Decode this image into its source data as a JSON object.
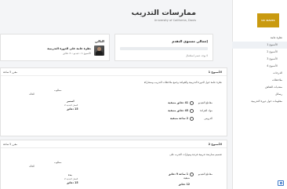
{
  "header": {
    "title": "ممارسات التدريب",
    "subtitle": "University of California, Davis"
  },
  "sidebar": {
    "logo_text": "UC DAVIS",
    "items": [
      {
        "label": "نظرة عامة",
        "sub": false,
        "active": false
      },
      {
        "label": "الأسبوع 1",
        "sub": true,
        "active": true
      },
      {
        "label": "الأسبوع 2",
        "sub": true,
        "active": false
      },
      {
        "label": "الأسبوع 3",
        "sub": true,
        "active": false
      },
      {
        "label": "الأسبوع 4",
        "sub": true,
        "active": false
      },
      {
        "label": "الدرجات",
        "sub": false,
        "active": false
      },
      {
        "label": "ملاحظات",
        "sub": false,
        "active": false
      },
      {
        "label": "منتديات النقاش",
        "sub": false,
        "active": false
      },
      {
        "label": "رسائل",
        "sub": false,
        "active": false
      },
      {
        "label": "معلومات حول دورة التدريبية",
        "sub": false,
        "active": false
      }
    ]
  },
  "progress_card": {
    "title": "إجمالي مستوى التقدم",
    "caption": "لا يوجد عنصر استكمال",
    "progress": 0
  },
  "next_card": {
    "title": "التالي",
    "item_title": "نظرة عامة على الدورة التدريبية",
    "item_meta": "الأسبوع 1 • فيديو • 3 دقائق"
  },
  "sections": [
    {
      "title": "الأسبوع 1",
      "due": "مقرر 5 ساعة",
      "description": "نظرة عامة حول الدورة التدريبية والقواعد وجمع ملاحظات التدريب ومشاركة",
      "col_due": "مطلوب",
      "col_status": "الحالة",
      "rows": [
        {
          "label": "مقاطع الفيديو",
          "value": "41 دقائق متبقية"
        },
        {
          "label": "مواد القراءة",
          "value": "45 دقائق متبقية"
        },
        {
          "label": "الدروس",
          "value": "2 ساعة متبقية"
        }
      ],
      "status_primary": "استمر",
      "status_secondary": "العمل البدنية 2",
      "status_minutes": "15 دقائق"
    },
    {
      "title": "الأسبوع 2",
      "due": "مقرر 5 ساعة",
      "description": "تصميم ممارسة تدريبية فردية ومهارات التدرب على",
      "col_due": "مطلوب",
      "col_status": "الحالة",
      "rows": [
        {
          "label": "مقاطع الفيديو",
          "value": "1 ساعة 9 دقائق"
        },
        {
          "label": "",
          "value": "متبقية"
        },
        {
          "label": "",
          "value": "12 دقائق"
        }
      ],
      "status_primary": "بدء",
      "status_secondary": "العمل البدنية 2",
      "status_minutes": "15 دقائق"
    }
  ],
  "colors": {
    "accent": "#3c8dbc",
    "brand": "#c99a10"
  }
}
